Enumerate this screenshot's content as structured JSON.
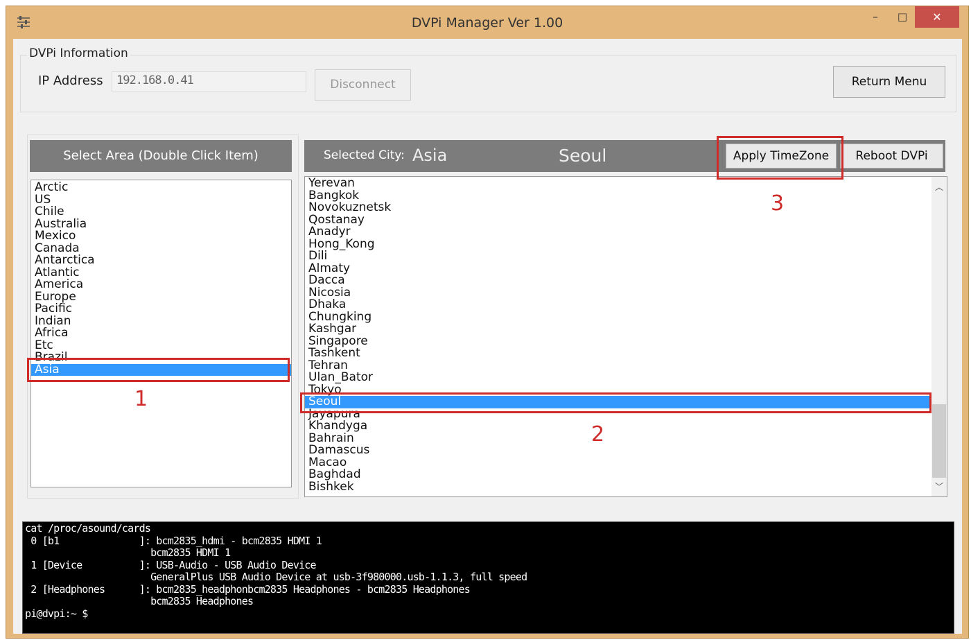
{
  "window": {
    "title": "DVPi Manager Ver 1.00",
    "minimize": "–",
    "maximize": "□",
    "close": "✕"
  },
  "info": {
    "group_label": "DVPi Information",
    "ip_label": "IP Address",
    "ip_value": "192.168.0.41",
    "disconnect_label": "Disconnect",
    "return_label": "Return Menu"
  },
  "area": {
    "header": "Select Area (Double Click Item)",
    "items": [
      "Arctic",
      "US",
      "Chile",
      "Australia",
      "Mexico",
      "Canada",
      "Antarctica",
      "Atlantic",
      "America",
      "Europe",
      "Pacific",
      "Indian",
      "Africa",
      "Etc",
      "Brazil",
      "Asia"
    ],
    "selected": "Asia"
  },
  "city": {
    "label": "Selected City:",
    "selected_area": "Asia",
    "selected_city": "Seoul",
    "apply_label": "Apply TimeZone",
    "reboot_label": "Reboot DVPi",
    "items": [
      "Yerevan",
      "Bangkok",
      "Novokuznetsk",
      "Qostanay",
      "Anadyr",
      "Hong_Kong",
      "Dili",
      "Almaty",
      "Dacca",
      "Nicosia",
      "Dhaka",
      "Chungking",
      "Kashgar",
      "Singapore",
      "Tashkent",
      "Tehran",
      "Ulan_Bator",
      "Tokyo",
      "Seoul",
      "Jayapura",
      "Khandyga",
      "Bahrain",
      "Damascus",
      "Macao",
      "Baghdad",
      "Bishkek"
    ]
  },
  "annotations": {
    "a1": "1",
    "a2": "2",
    "a3": "3",
    "color": "#cf2b2b"
  },
  "terminal": {
    "lines": [
      "cat /proc/asound/cards",
      " 0 [b1              ]: bcm2835_hdmi - bcm2835 HDMI 1",
      "                      bcm2835 HDMI 1",
      " 1 [Device          ]: USB-Audio - USB Audio Device",
      "                      GeneralPlus USB Audio Device at usb-3f980000.usb-1.1.3, full speed",
      " 2 [Headphones      ]: bcm2835_headphonbcm2835 Headphones - bcm2835 Headphones",
      "                      bcm2835 Headphones",
      "pi@dvpi:~ $"
    ]
  },
  "colors": {
    "frame": "#e4b77c",
    "header_gray": "#7c7c7c",
    "selection": "#3399ff",
    "close_button": "#c7504a"
  }
}
